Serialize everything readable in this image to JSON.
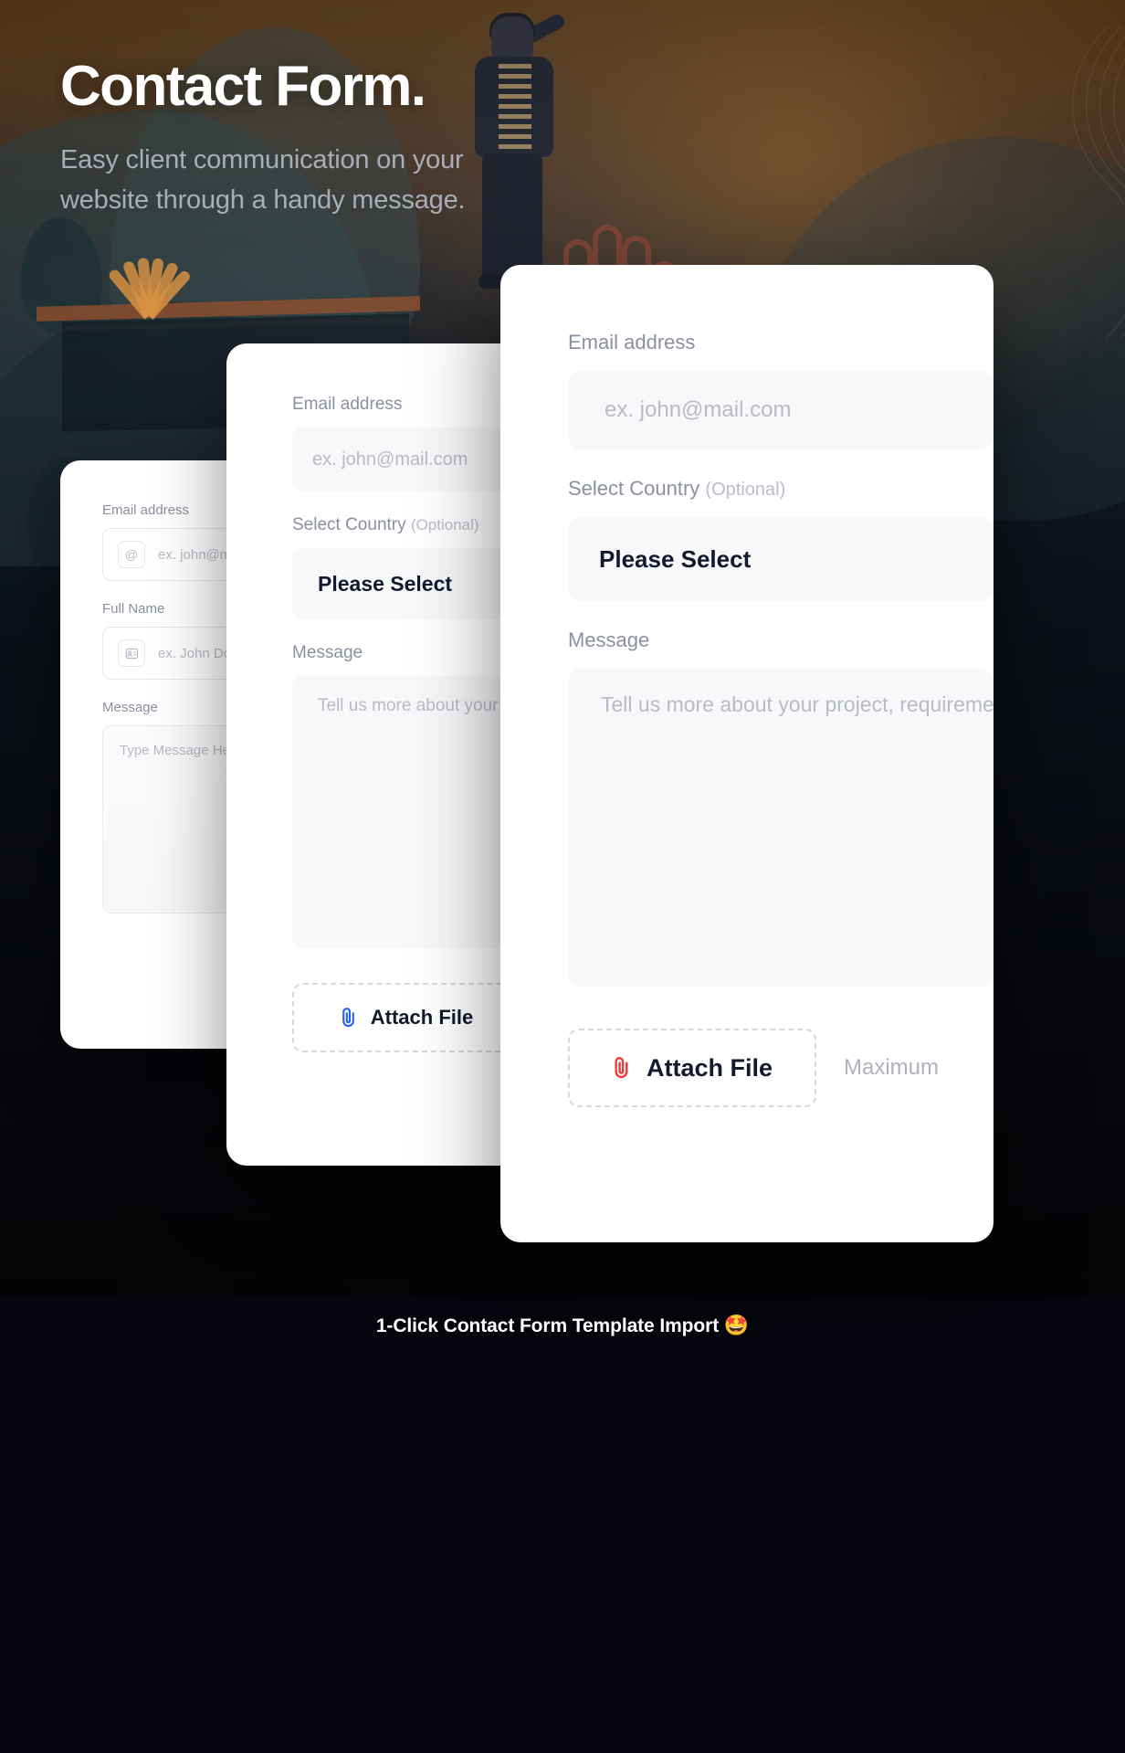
{
  "hero": {
    "title": "Contact Form.",
    "subtitle": "Easy client communication on your website through a handy message."
  },
  "cards": {
    "back": {
      "email_label": "Email address",
      "email_placeholder": "ex. john@mail.com",
      "email_icon": "at-sign-icon",
      "name_label": "Full Name",
      "name_placeholder": "ex. John Doe",
      "name_icon": "user-card-icon",
      "message_label": "Message",
      "message_placeholder": "Type Message Here"
    },
    "middle": {
      "email_label": "Email address",
      "email_placeholder": "ex. john@mail.com",
      "country_label": "Select Country",
      "country_optional": "(Optional)",
      "country_value": "Please Select",
      "message_label": "Message",
      "message_placeholder": "Tell us more about your project, requirements",
      "attach_label": "Attach File",
      "attach_icon": "paperclip-icon",
      "attach_icon_color": "#2563f0"
    },
    "front": {
      "email_label": "Email address",
      "email_placeholder": "ex. john@mail.com",
      "country_label": "Select Country",
      "country_optional": "(Optional)",
      "country_value": "Please Select",
      "message_label": "Message",
      "message_placeholder": "Tell us more about your project, requirements",
      "attach_label": "Attach File",
      "attach_icon": "paperclip-icon",
      "attach_icon_color": "#ef3b3b",
      "max_note": "Maximum"
    }
  },
  "caption": {
    "prefix": "1-Click ",
    "bold": "Contact Form Template Import",
    "emoji": "🤩"
  },
  "colors": {
    "label": "#8b90a0",
    "placeholder": "#b7bbc6",
    "value": "#111a2e",
    "field_bg": "#f8f8fa",
    "card_bg": "#ffffff",
    "page_bg": "#05050d",
    "hero_title": "#ffffff",
    "hero_sub": "#a9adb8"
  }
}
